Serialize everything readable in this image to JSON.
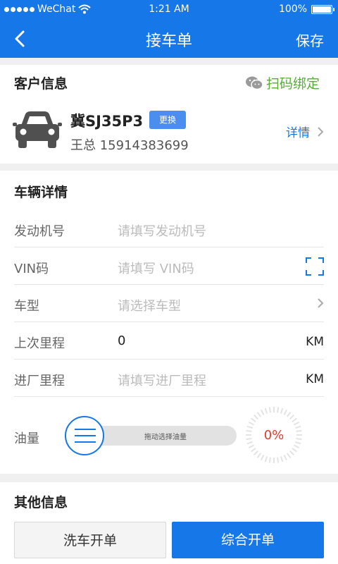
{
  "status_bar": {
    "carrier": "WeChat",
    "time": "1:21 AM",
    "battery": "100%"
  },
  "nav": {
    "title": "接车单",
    "save_label": "保存"
  },
  "customer": {
    "section_title": "客户信息",
    "scan_label": "扫码绑定",
    "plate": "冀SJ35P3",
    "change_label": "更换",
    "owner": "王总 15914383699",
    "detail_label": "详情"
  },
  "vehicle": {
    "section_title": "车辆详情",
    "engine": {
      "label": "发动机号",
      "placeholder": "请填写发动机号"
    },
    "vin": {
      "label": "VIN码",
      "placeholder": "请填写 VIN码"
    },
    "model": {
      "label": "车型",
      "placeholder": "请选择车型"
    },
    "last_mileage": {
      "label": "上次里程",
      "value": "0",
      "unit": "KM"
    },
    "entry_mileage": {
      "label": "进厂里程",
      "placeholder": "请填写进厂里程",
      "unit": "KM"
    },
    "fuel": {
      "label": "油量",
      "slider_hint": "拖动选择油量",
      "percent_text": "0%",
      "level": 0
    }
  },
  "other": {
    "section_title": "其他信息",
    "wash_button": "洗车开单",
    "full_button": "综合开单"
  },
  "colors": {
    "primary": "#1677e8",
    "wechat_green": "#54ae34",
    "alert_red": "#e03b2c"
  }
}
